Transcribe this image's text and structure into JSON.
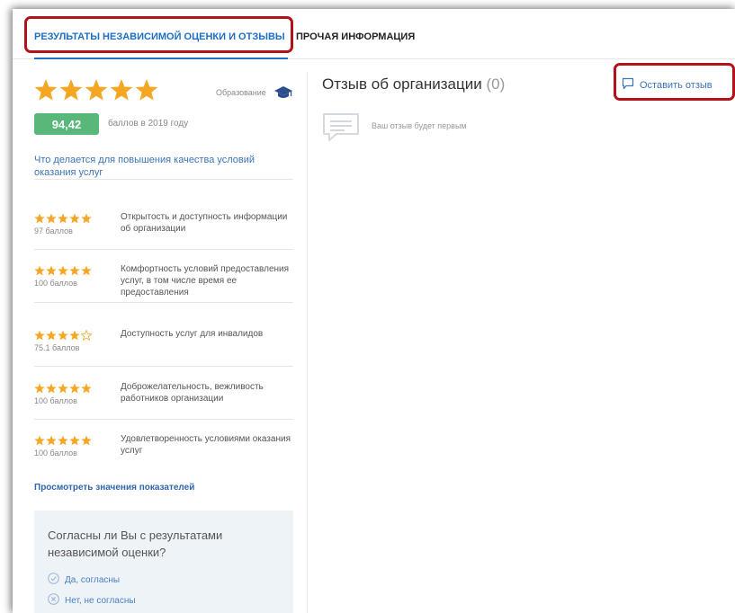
{
  "tabs": {
    "active_label": "РЕЗУЛЬТАТЫ НЕЗАВИСИМОЙ ОЦЕНКИ И ОТЗЫВЫ",
    "other_label": "ПРОЧАЯ ИНФОРМАЦИЯ"
  },
  "rating": {
    "stars": 5,
    "category": "Образование",
    "category_icon": "graduation-cap-icon",
    "score": "94,42",
    "score_caption": "баллов в 2019 году",
    "improve_link": "Что делается для повышения качества условий оказания услуг"
  },
  "criteria": [
    {
      "stars": 5,
      "score": "97 баллов",
      "label": "Открытость и доступность информации об организации"
    },
    {
      "stars": 5,
      "score": "100 баллов",
      "label": "Комфортность условий предоставления услуг, в том числе время ее предоставления"
    },
    {
      "stars": 4,
      "score": "75.1 баллов",
      "label": "Доступность услуг для инвалидов"
    },
    {
      "stars": 5,
      "score": "100 баллов",
      "label": "Доброжелательность, вежливость работников организации"
    },
    {
      "stars": 5,
      "score": "100 баллов",
      "label": "Удовлетворенность условиями оказания услуг"
    }
  ],
  "indicators_link": "Просмотреть значения показателей",
  "agree": {
    "question": "Согласны ли Вы с результатами независимой оценки?",
    "yes": "Да, согласны",
    "no": "Нет, не согласны"
  },
  "reviews": {
    "title": "Отзыв об организации",
    "count": "(0)",
    "leave_label": "Оставить отзыв",
    "empty_text": "Ваш отзыв будет первым"
  },
  "colors": {
    "star": "#f5a623",
    "accent": "#1e6fc4",
    "badge": "#5ab77a",
    "highlight": "#b3121b"
  }
}
